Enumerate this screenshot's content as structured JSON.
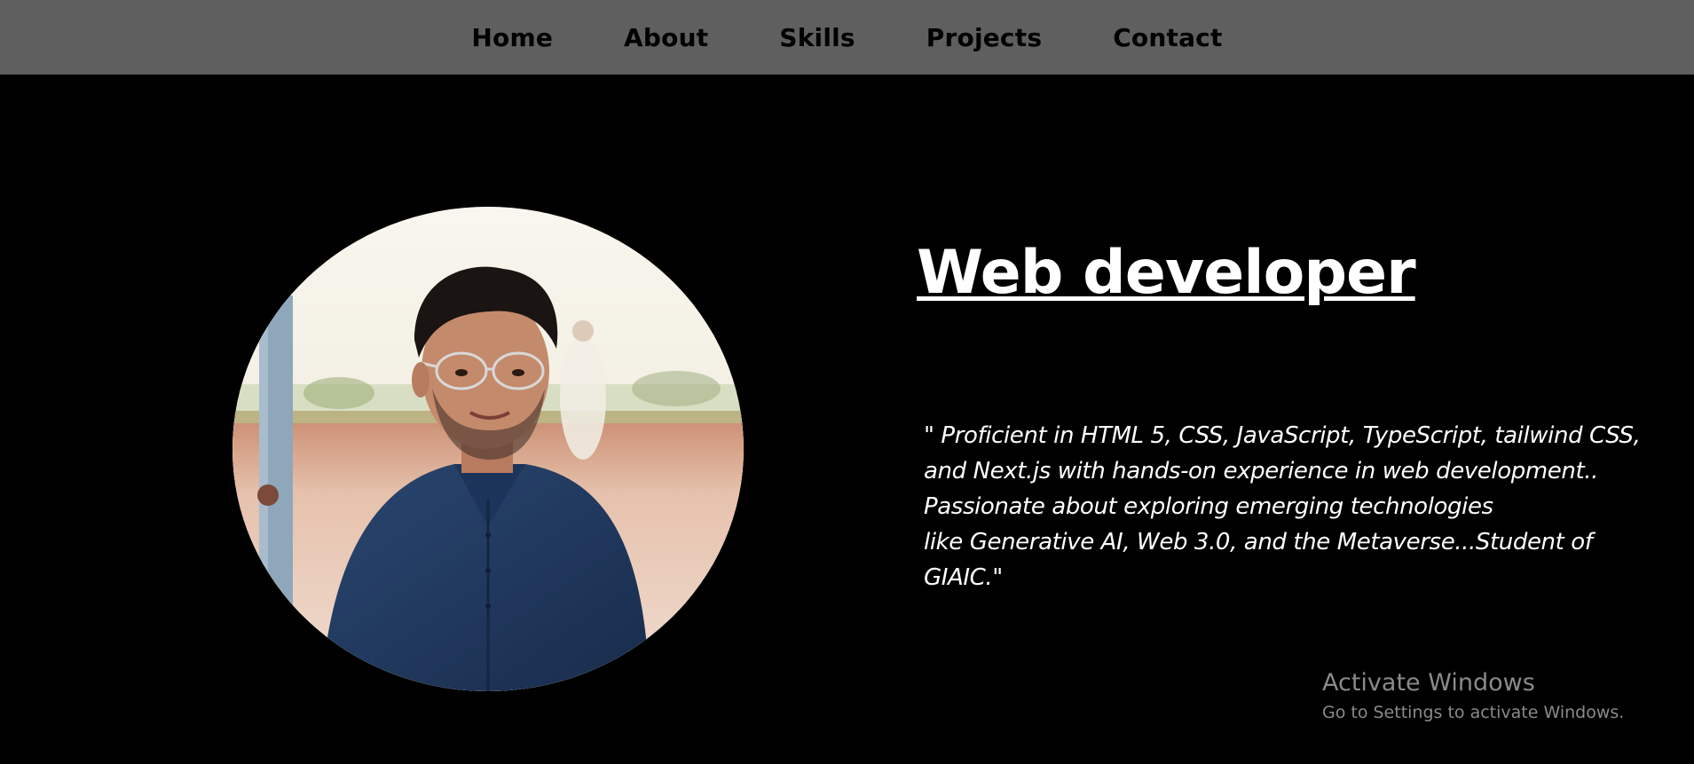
{
  "nav": {
    "items": [
      {
        "label": "Home"
      },
      {
        "label": "About"
      },
      {
        "label": "Skills"
      },
      {
        "label": "Projects"
      },
      {
        "label": "Contact"
      }
    ]
  },
  "hero": {
    "headline": "Web developer",
    "bio_lines": [
      "\" Proficient in HTML 5, CSS, JavaScript, TypeScript, tailwind CSS,",
      "and Next.js with hands-on experience in web development..",
      "Passionate about exploring emerging technologies",
      "like Generative AI, Web 3.0, and the Metaverse...Student of",
      "GIAIC.\""
    ]
  },
  "watermark": {
    "title": "Activate Windows",
    "subtitle": "Go to Settings to activate Windows."
  },
  "colors": {
    "navbar_bg": "#5f5f5f",
    "page_bg": "#000000",
    "text_primary": "#ffffff",
    "nav_text": "#000000"
  }
}
